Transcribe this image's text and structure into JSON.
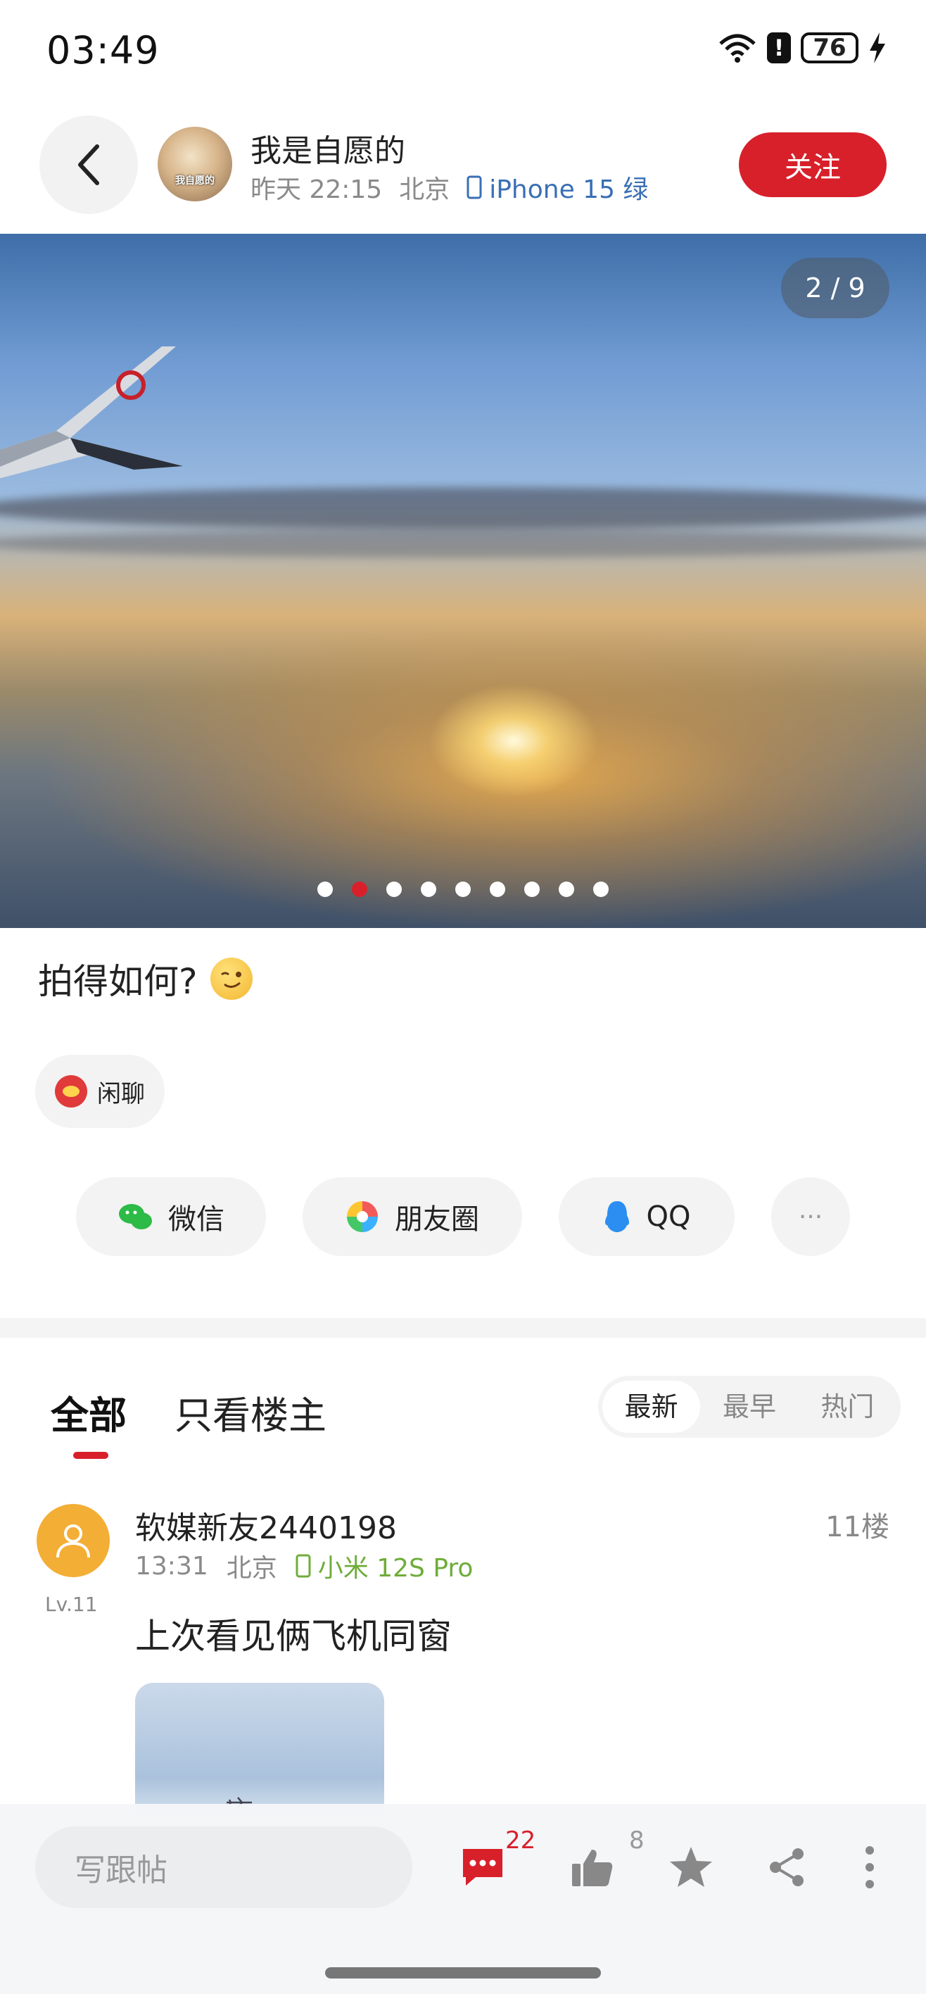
{
  "status_bar": {
    "time": "03:49",
    "battery": "76"
  },
  "header": {
    "author_name": "我是自愿的",
    "avatar_text": "我自愿的",
    "time": "昨天 22:15",
    "location": "北京",
    "device": "iPhone 15 绿",
    "follow_label": "关注"
  },
  "gallery": {
    "indicator": "2 / 9",
    "count": 9,
    "current": 2
  },
  "post": {
    "text": "拍得如何?",
    "topic": "闲聊"
  },
  "share": {
    "wechat": "微信",
    "moments": "朋友圈",
    "qq": "QQ",
    "more": "···"
  },
  "comments_header": {
    "tab_all": "全部",
    "tab_op": "只看楼主",
    "sort_options": [
      "最新",
      "最早",
      "热门"
    ],
    "active_sort": 0
  },
  "comment": {
    "name": "软媒新友2440198",
    "level": "Lv.11",
    "time": "13:31",
    "location": "北京",
    "device": "小米 12S Pro",
    "floor": "11楼",
    "text": "上次看见俩飞机同窗"
  },
  "bottom_bar": {
    "reply_placeholder": "写跟帖",
    "comment_count": "22",
    "like_count": "8"
  },
  "colors": {
    "accent": "#d8202a",
    "device_blue": "#3a6fb5",
    "device_green": "#6fad3a"
  }
}
